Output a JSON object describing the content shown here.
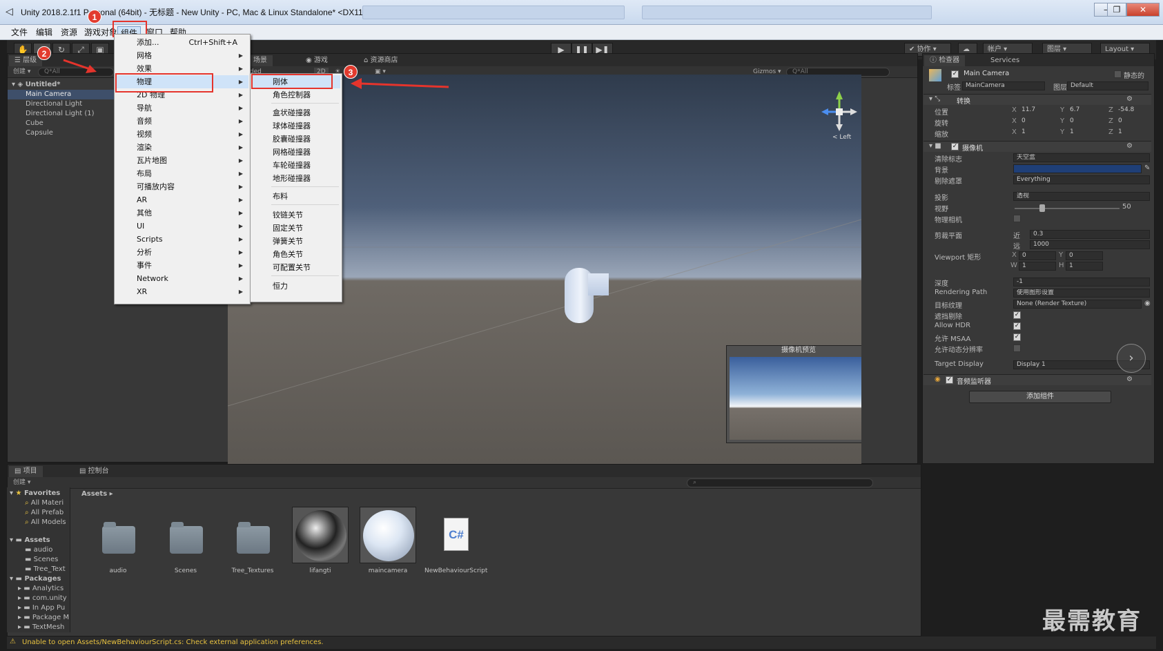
{
  "window": {
    "title": "Unity 2018.2.1f1 Personal (64bit) - 无标题 - New Unity - PC, Mac & Linux Standalone* <DX11>"
  },
  "menubar": {
    "items": [
      "文件",
      "编辑",
      "资源",
      "游戏对象",
      "组件",
      "窗口",
      "帮助"
    ]
  },
  "toolbar": {
    "collab": "协作",
    "account": "帐户",
    "layers": "图层",
    "layout": "Layout"
  },
  "hierarchy": {
    "tab": "层级",
    "create": "创建",
    "search_placeholder": "Q*All",
    "scene": "Untitled*",
    "items": [
      "Main Camera",
      "Directional Light",
      "Directional Light (1)",
      "Cube",
      "Capsule"
    ]
  },
  "scene": {
    "tabs": [
      "场景",
      "游戏",
      "资源商店"
    ],
    "shading": "Shaded",
    "mode_2d": "2D",
    "gizmos": "Gizmos",
    "search_placeholder": "Q*All",
    "gizmo_label": "< Left",
    "camera_preview_title": "摄像机预览"
  },
  "component_menu": {
    "items": [
      {
        "label": "添加...",
        "shortcut": "Ctrl+Shift+A"
      },
      {
        "label": "网格"
      },
      {
        "label": "效果"
      },
      {
        "label": "物理"
      },
      {
        "label": "2D 物理"
      },
      {
        "label": "导航"
      },
      {
        "label": "音频"
      },
      {
        "label": "视频"
      },
      {
        "label": "渲染"
      },
      {
        "label": "瓦片地图"
      },
      {
        "label": "布局"
      },
      {
        "label": "可播放内容"
      },
      {
        "label": "AR"
      },
      {
        "label": "其他"
      },
      {
        "label": "UI"
      },
      {
        "label": "Scripts"
      },
      {
        "label": "分析"
      },
      {
        "label": "事件"
      },
      {
        "label": "Network"
      },
      {
        "label": "XR"
      }
    ]
  },
  "physics_submenu": {
    "groups": [
      [
        "刚体",
        "角色控制器"
      ],
      [
        "盒状碰撞器",
        "球体碰撞器",
        "胶囊碰撞器",
        "网格碰撞器",
        "车轮碰撞器",
        "地形碰撞器"
      ],
      [
        "布料"
      ],
      [
        "铰链关节",
        "固定关节",
        "弹簧关节",
        "角色关节",
        "可配置关节"
      ],
      [
        "恒力"
      ]
    ]
  },
  "annotations": {
    "step1": "1",
    "step2": "2",
    "step3": "3",
    "color": "#e5342c"
  },
  "inspector": {
    "tabs": [
      "检查器",
      "Services"
    ],
    "object_name": "Main Camera",
    "static_label": "静态的",
    "tag_label": "标签",
    "tag_value": "MainCamera",
    "layer_label": "图层",
    "layer_value": "Default",
    "transform": {
      "title": "转换",
      "position_label": "位置",
      "rotation_label": "旋转",
      "scale_label": "缩放",
      "position": {
        "x": "11.7",
        "y": "6.7",
        "z": "-54.8"
      },
      "rotation": {
        "x": "0",
        "y": "0",
        "z": "0"
      },
      "scale": {
        "x": "1",
        "y": "1",
        "z": "1"
      }
    },
    "camera": {
      "title": "摄像机",
      "clear_flags_label": "清除标志",
      "clear_flags_value": "天空盒",
      "background_label": "背景",
      "culling_mask_label": "剔除遮罩",
      "culling_mask_value": "Everything",
      "projection_label": "投影",
      "projection_value": "透视",
      "fov_label": "视野",
      "fov_value": "50",
      "physical_label": "物理相机",
      "clipping_label": "剪裁平面",
      "near_label": "近",
      "near_value": "0.3",
      "far_label": "远",
      "far_value": "1000",
      "viewport_label": "Viewport 矩形",
      "vp_x": "0",
      "vp_y": "0",
      "vp_w": "1",
      "vp_h": "1",
      "depth_label": "深度",
      "depth_value": "-1",
      "rendering_path_label": "Rendering Path",
      "rendering_path_value": "使用图形设置",
      "target_texture_label": "目标纹理",
      "target_texture_value": "None (Render Texture)",
      "occlusion_label": "遮挡剔除",
      "hdr_label": "Allow HDR",
      "msaa_label": "允许 MSAA",
      "dynamic_res_label": "允许动态分辨率",
      "target_display_label": "Target Display",
      "target_display_value": "Display 1",
      "background_color": "#1f3f77"
    },
    "audio_listener": "音频监听器",
    "add_component": "添加组件"
  },
  "project": {
    "tabs": [
      "项目",
      "控制台"
    ],
    "create": "创建",
    "favorites_label": "Favorites",
    "favorites": [
      "All Materi",
      "All Prefab",
      "All Models"
    ],
    "assets_label": "Assets",
    "assets_tree": [
      "audio",
      "Scenes",
      "Tree_Text"
    ],
    "packages_label": "Packages",
    "packages_tree": [
      "Analytics",
      "com.unity",
      "In App Pu",
      "Package M",
      "TextMesh"
    ],
    "breadcrumb": "Assets",
    "assets": [
      "audio",
      "Scenes",
      "Tree_Textures",
      "lifangti",
      "maincamera",
      "NewBehaviourScript"
    ],
    "csharp": "C#"
  },
  "status": {
    "message": "Unable to open Assets/NewBehaviourScript.cs: Check external application preferences."
  },
  "watermark": "最需教育"
}
